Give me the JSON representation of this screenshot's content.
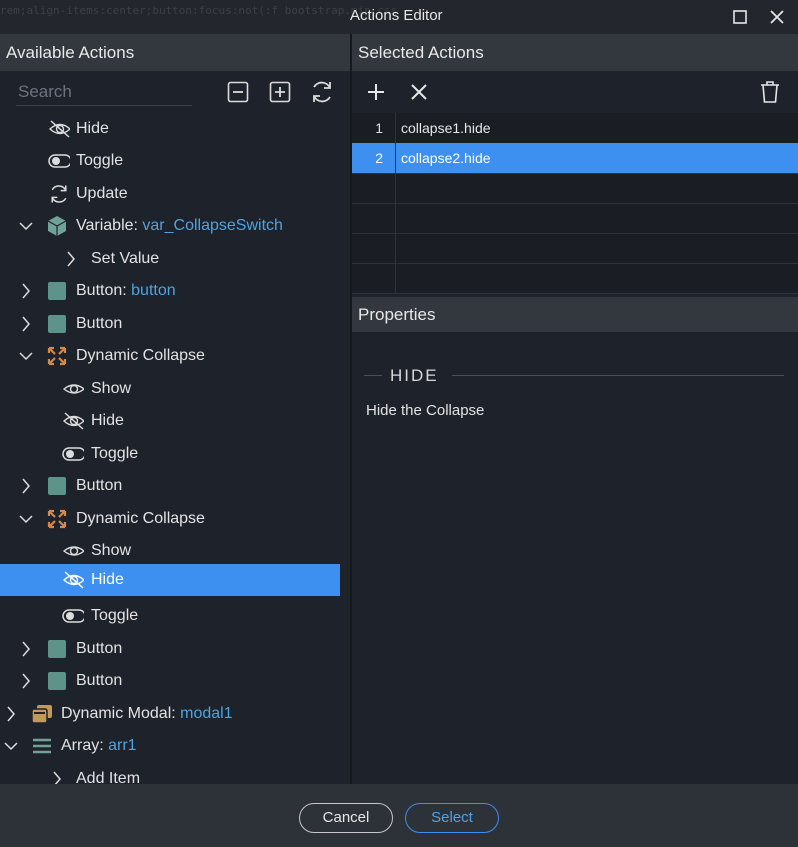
{
  "window": {
    "title": "Actions Editor",
    "background_code": "rem;align-items:center;button:focus:not(:f  bootstrap.min.css"
  },
  "left_panel": {
    "header": "Available Actions",
    "search_placeholder": "Search",
    "tree": [
      {
        "label": "Hide",
        "icon": "eye-slash-icon"
      },
      {
        "label": "Toggle",
        "icon": "toggle-icon"
      },
      {
        "label": "Update",
        "icon": "refresh-icon"
      },
      {
        "label": "Variable: ",
        "value": "var_CollapseSwitch",
        "icon": "cube-icon",
        "expanded": true
      },
      {
        "label": "Set Value",
        "icon": ""
      },
      {
        "label": "Button: ",
        "value": "button",
        "icon": "square-icon",
        "expanded": false
      },
      {
        "label": "Button",
        "icon": "square-icon",
        "expanded": false
      },
      {
        "label": "Dynamic Collapse",
        "icon": "collapse-arrows-icon",
        "expanded": true
      },
      {
        "label": "Show",
        "icon": "eye-icon"
      },
      {
        "label": "Hide",
        "icon": "eye-slash-icon"
      },
      {
        "label": "Toggle",
        "icon": "toggle-icon"
      },
      {
        "label": "Button",
        "icon": "square-icon",
        "expanded": false
      },
      {
        "label": "Dynamic Collapse",
        "icon": "collapse-arrows-icon",
        "expanded": true
      },
      {
        "label": "Show",
        "icon": "eye-icon"
      },
      {
        "label": "Hide",
        "icon": "eye-slash-icon",
        "selected": true
      },
      {
        "label": "Toggle",
        "icon": "toggle-icon"
      },
      {
        "label": "Button",
        "icon": "square-icon",
        "expanded": false
      },
      {
        "label": "Button",
        "icon": "square-icon",
        "expanded": false
      },
      {
        "label": "Dynamic Modal: ",
        "value": "modal1",
        "icon": "modal-icon",
        "expanded": false
      },
      {
        "label": "Array: ",
        "value": "arr1",
        "icon": "list-icon",
        "expanded": true
      },
      {
        "label": "Add Item",
        "icon": ""
      }
    ]
  },
  "selected_actions": {
    "header": "Selected Actions",
    "rows": [
      {
        "num": "1",
        "text": "collapse1.hide"
      },
      {
        "num": "2",
        "text": "collapse2.hide",
        "selected": true
      },
      {
        "num": "",
        "text": ""
      },
      {
        "num": "",
        "text": ""
      },
      {
        "num": "",
        "text": ""
      },
      {
        "num": "",
        "text": ""
      }
    ]
  },
  "properties": {
    "header": "Properties",
    "title": "HIDE",
    "description": "Hide the Collapse"
  },
  "footer": {
    "cancel_label": "Cancel",
    "select_label": "Select"
  },
  "colors": {
    "accent": "#3d8ff0",
    "variable_value": "#4fa3e0",
    "component_square": "#5e9389",
    "collapse_icon": "#d4884a"
  }
}
